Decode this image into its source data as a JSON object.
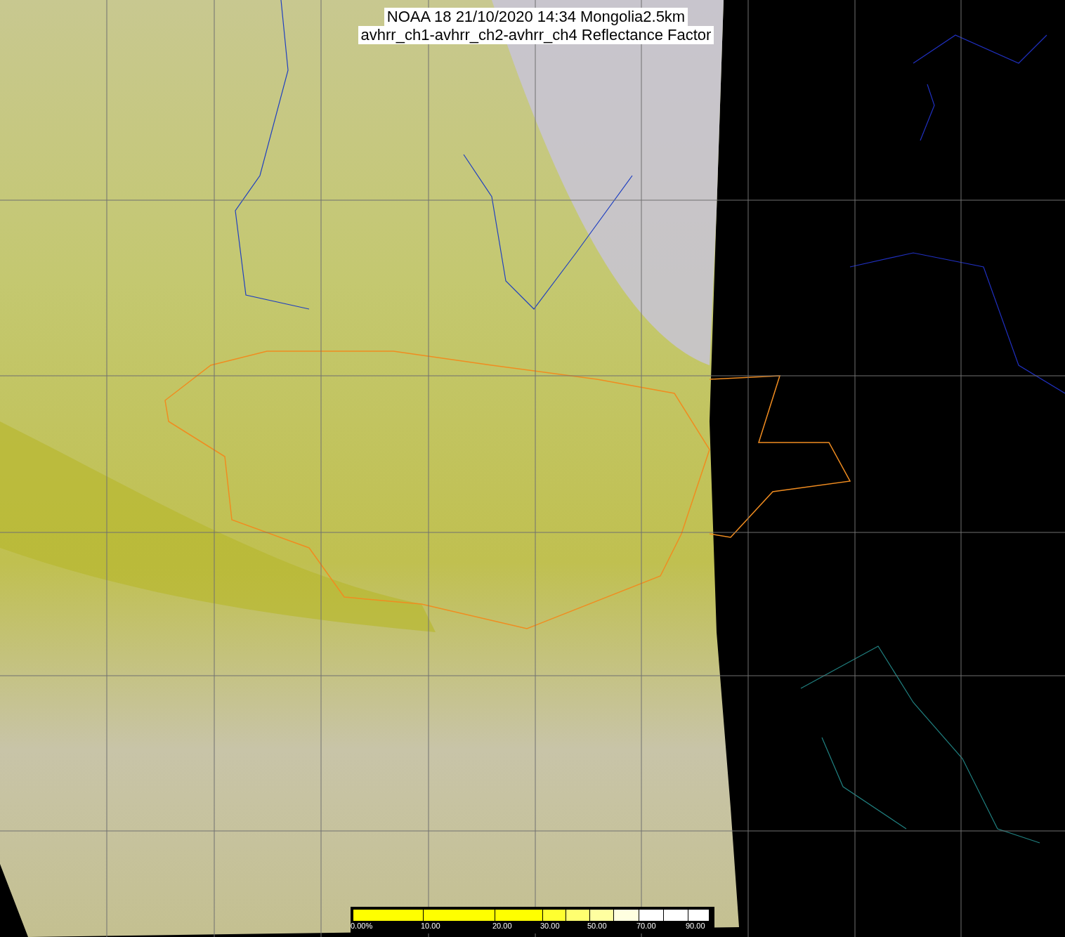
{
  "title_lines": [
    "NOAA 18 21/10/2020 14:34 Mongolia2.5km",
    "avhrr_ch1-avhrr_ch2-avhrr_ch4 Reflectance Factor"
  ],
  "colorbar": {
    "segments": [
      {
        "color": "#ffff00",
        "label": "0.00%"
      },
      {
        "color": "#ffff00",
        "label": "10.00"
      },
      {
        "color": "#ffff00",
        "label": "20.00"
      },
      {
        "color": "#ffff30",
        "label": "30.00"
      },
      {
        "color": "#ffff70"
      },
      {
        "color": "#ffffa0",
        "label": "50.00"
      },
      {
        "color": "#ffffe0"
      },
      {
        "color": "#ffffff",
        "label": "70.00"
      },
      {
        "color": "#ffffff"
      },
      {
        "color": "#ffffff",
        "label": "90.00"
      }
    ]
  }
}
